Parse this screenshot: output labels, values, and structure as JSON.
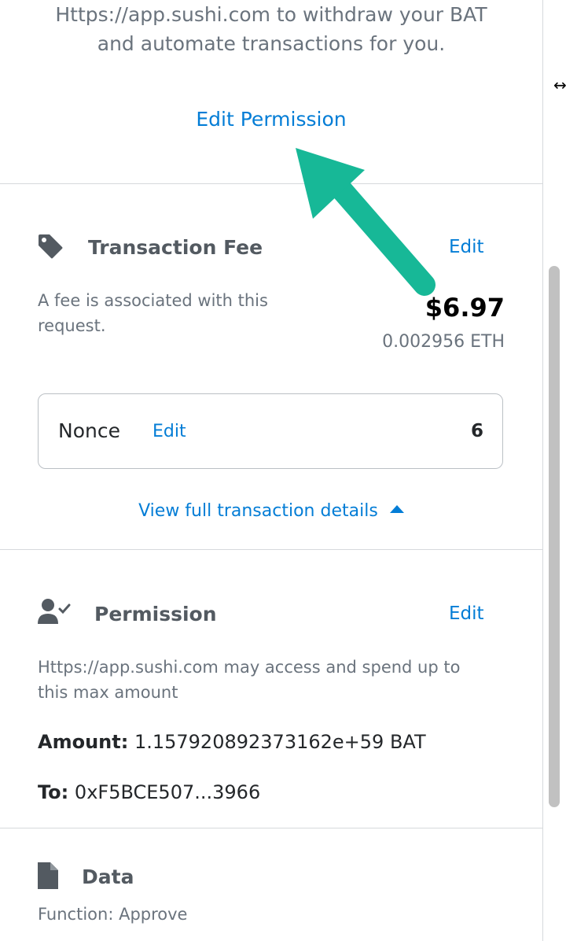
{
  "intro": {
    "line1": "Https://app.sushi.com to withdraw your BAT",
    "line2": "and automate transactions for you.",
    "edit_permission": "Edit Permission"
  },
  "fee": {
    "title": "Transaction Fee",
    "edit": "Edit",
    "desc_line1": "A fee is associated with this",
    "desc_line2": "request.",
    "usd": "$6.97",
    "eth": "0.002956 ETH"
  },
  "nonce": {
    "label": "Nonce",
    "edit": "Edit",
    "value": "6"
  },
  "details_link": "View full transaction details",
  "permission": {
    "title": "Permission",
    "edit": "Edit",
    "desc_line1": "Https://app.sushi.com may access and spend up to",
    "desc_line2": "this max amount",
    "amount_label": "Amount:",
    "amount_value": "1.157920892373162e+59 BAT",
    "to_label": "To:",
    "to_value": "0xF5BCE507...3966"
  },
  "data_section": {
    "title": "Data",
    "function": "Function: Approve"
  },
  "colors": {
    "link": "#037dd6",
    "arrow": "#17b897",
    "text_gray": "#6a737d"
  }
}
